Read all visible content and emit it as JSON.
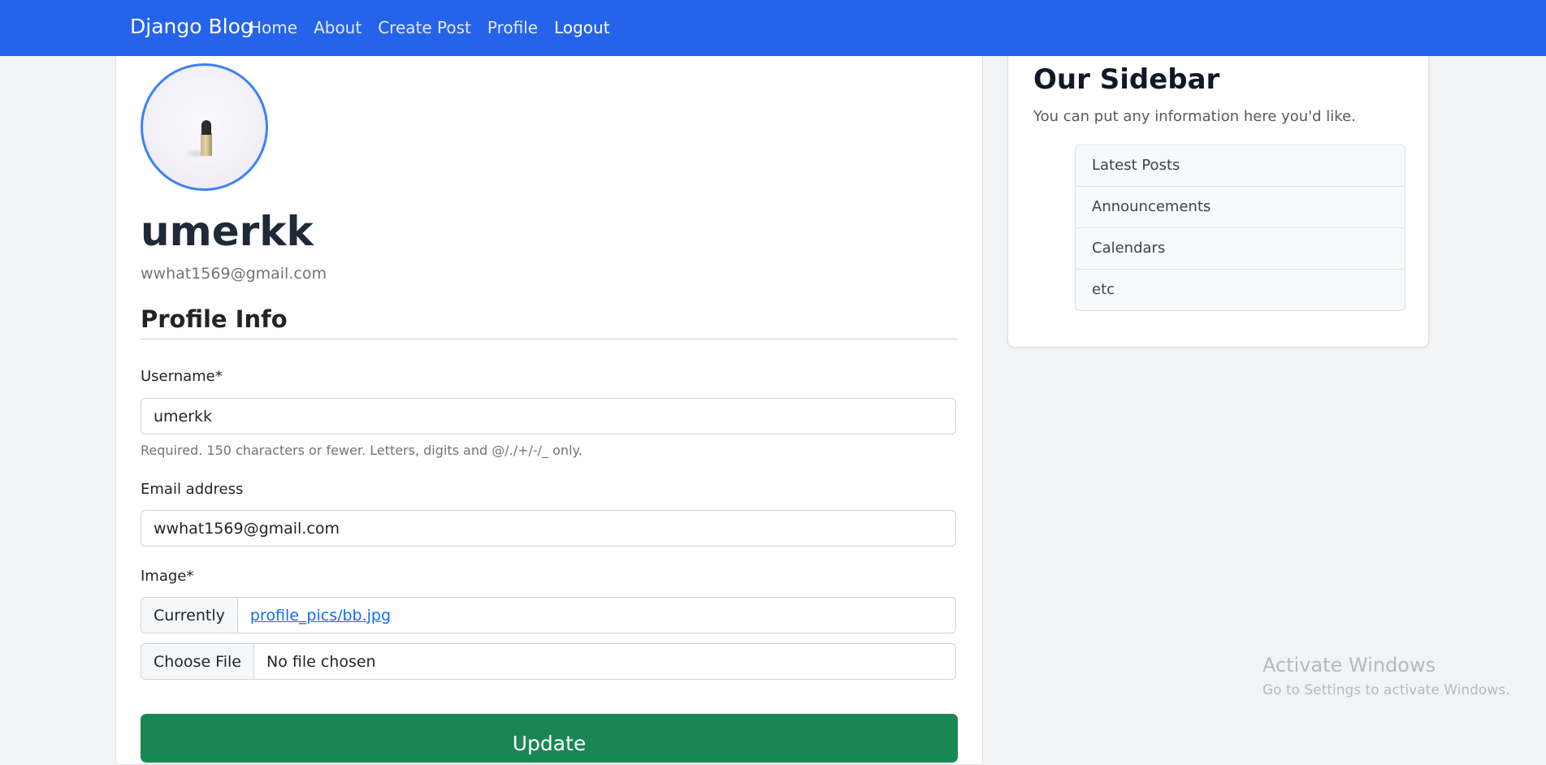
{
  "navbar": {
    "brand": "Django Blog",
    "links": [
      "Home",
      "About",
      "Create Post",
      "Profile"
    ],
    "logout": "Logout"
  },
  "profile": {
    "username": "umerkk",
    "email": "wwhat1569@gmail.com"
  },
  "form": {
    "section_title": "Profile Info",
    "username_label": "Username*",
    "username_value": "umerkk",
    "username_help": "Required. 150 characters or fewer. Letters, digits and @/./+/-/_ only.",
    "email_label": "Email address",
    "email_value": "wwhat1569@gmail.com",
    "image_label": "Image*",
    "currently_label": "Currently",
    "current_image_link": "profile_pics/bb.jpg",
    "choose_file_label": "Choose File",
    "no_file_text": "No file chosen",
    "submit_label": "Update"
  },
  "sidebar": {
    "title": "Our Sidebar",
    "description": "You can put any information here you'd like.",
    "items": [
      "Latest Posts",
      "Announcements",
      "Calendars",
      "etc"
    ]
  },
  "watermark": {
    "title": "Activate Windows",
    "subtitle": "Go to Settings to activate Windows."
  },
  "colors": {
    "navbar": "#2563eb",
    "avatar_border": "#3b82f6",
    "update_button": "#198754",
    "link": "#0d6efd"
  }
}
